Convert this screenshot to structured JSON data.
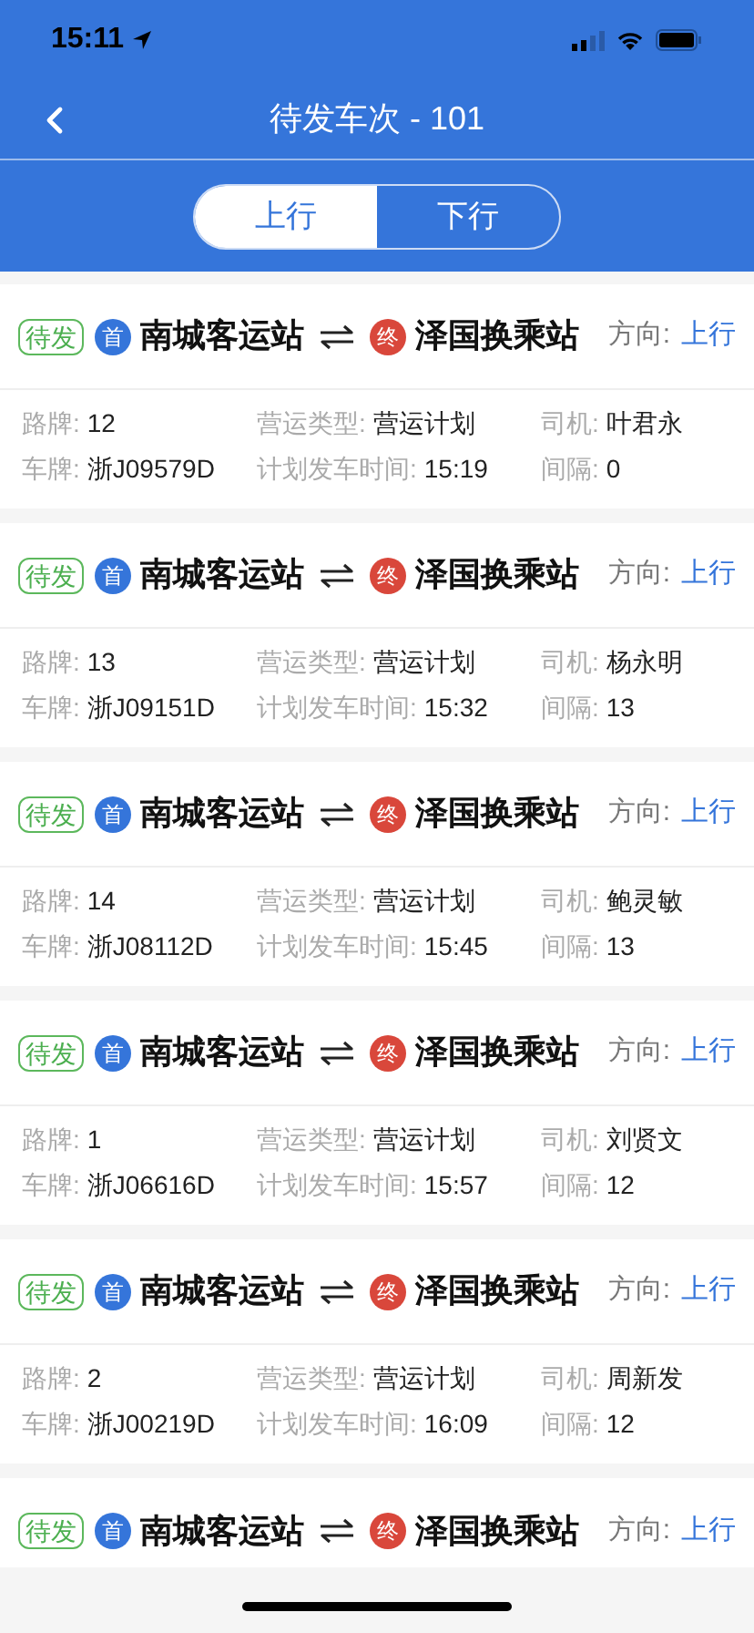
{
  "status_bar": {
    "time": "15:11"
  },
  "nav": {
    "title": "待发车次 - 101"
  },
  "segments": [
    {
      "label": "上行",
      "selected": true
    },
    {
      "label": "下行",
      "selected": false
    }
  ],
  "trips": [
    {
      "status": "待发",
      "start_badge": "首",
      "start": "南城客运站",
      "end_badge": "终",
      "end": "泽国换乘站",
      "direction_label": "方向:",
      "direction": "上行",
      "fields": [
        {
          "label": "路牌:",
          "value": "12"
        },
        {
          "label": "营运类型:",
          "value": "营运计划"
        },
        {
          "label": "司机:",
          "value": "叶君永"
        },
        {
          "label": "车牌:",
          "value": "浙J09579D"
        },
        {
          "label": "计划发车时间:",
          "value": "15:19"
        },
        {
          "label": "间隔:",
          "value": "0"
        }
      ]
    },
    {
      "status": "待发",
      "start_badge": "首",
      "start": "南城客运站",
      "end_badge": "终",
      "end": "泽国换乘站",
      "direction_label": "方向:",
      "direction": "上行",
      "fields": [
        {
          "label": "路牌:",
          "value": "13"
        },
        {
          "label": "营运类型:",
          "value": "营运计划"
        },
        {
          "label": "司机:",
          "value": "杨永明"
        },
        {
          "label": "车牌:",
          "value": "浙J09151D"
        },
        {
          "label": "计划发车时间:",
          "value": "15:32"
        },
        {
          "label": "间隔:",
          "value": "13"
        }
      ]
    },
    {
      "status": "待发",
      "start_badge": "首",
      "start": "南城客运站",
      "end_badge": "终",
      "end": "泽国换乘站",
      "direction_label": "方向:",
      "direction": "上行",
      "fields": [
        {
          "label": "路牌:",
          "value": "14"
        },
        {
          "label": "营运类型:",
          "value": "营运计划"
        },
        {
          "label": "司机:",
          "value": "鲍灵敏"
        },
        {
          "label": "车牌:",
          "value": "浙J08112D"
        },
        {
          "label": "计划发车时间:",
          "value": "15:45"
        },
        {
          "label": "间隔:",
          "value": "13"
        }
      ]
    },
    {
      "status": "待发",
      "start_badge": "首",
      "start": "南城客运站",
      "end_badge": "终",
      "end": "泽国换乘站",
      "direction_label": "方向:",
      "direction": "上行",
      "fields": [
        {
          "label": "路牌:",
          "value": "1"
        },
        {
          "label": "营运类型:",
          "value": "营运计划"
        },
        {
          "label": "司机:",
          "value": "刘贤文"
        },
        {
          "label": "车牌:",
          "value": "浙J06616D"
        },
        {
          "label": "计划发车时间:",
          "value": "15:57"
        },
        {
          "label": "间隔:",
          "value": "12"
        }
      ]
    },
    {
      "status": "待发",
      "start_badge": "首",
      "start": "南城客运站",
      "end_badge": "终",
      "end": "泽国换乘站",
      "direction_label": "方向:",
      "direction": "上行",
      "fields": [
        {
          "label": "路牌:",
          "value": "2"
        },
        {
          "label": "营运类型:",
          "value": "营运计划"
        },
        {
          "label": "司机:",
          "value": "周新发"
        },
        {
          "label": "车牌:",
          "value": "浙J00219D"
        },
        {
          "label": "计划发车时间:",
          "value": "16:09"
        },
        {
          "label": "间隔:",
          "value": "12"
        }
      ]
    },
    {
      "status": "待发",
      "start_badge": "首",
      "start": "南城客运站",
      "end_badge": "终",
      "end": "泽国换乘站",
      "direction_label": "方向:",
      "direction": "上行"
    }
  ]
}
